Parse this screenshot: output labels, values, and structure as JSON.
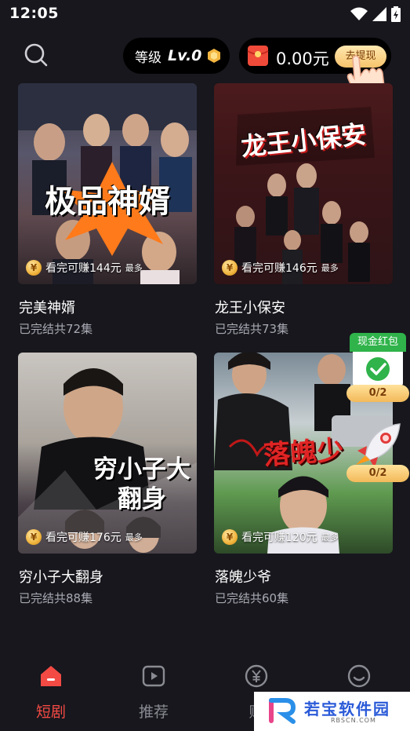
{
  "status_bar": {
    "time": "12:05"
  },
  "header": {
    "level_label": "等级",
    "level_value": "Lv.0",
    "wallet_amount": "0.00元",
    "withdraw_label": "去提现"
  },
  "dramas": [
    {
      "title": "完美神婿",
      "subtitle": "已完结共72集",
      "earn": "看完可赚144元",
      "earn_suffix": "最多",
      "poster_text": "极品神婿"
    },
    {
      "title": "龙王小保安",
      "subtitle": "已完结共73集",
      "earn": "看完可赚146元",
      "earn_suffix": "最多",
      "poster_text": "龙王小保安"
    },
    {
      "title": "穷小子大翻身",
      "subtitle": "已完结共88集",
      "earn": "看完可赚176元",
      "earn_suffix": "最多",
      "poster_text": "穷小子大翻身"
    },
    {
      "title": "落魄少爷",
      "subtitle": "已完结共60集",
      "earn": "看完可赚120元",
      "earn_suffix": "最多",
      "poster_text": "落魄少"
    }
  ],
  "coin_symbol": "¥",
  "redpacket": {
    "title": "现金红包",
    "progress": "0/2"
  },
  "rocket": {
    "progress": "0/2"
  },
  "nav": [
    {
      "label": "短剧",
      "icon": "home-icon",
      "active": true
    },
    {
      "label": "推荐",
      "icon": "play-icon",
      "active": false
    },
    {
      "label": "赚",
      "icon": "yen-icon",
      "active": false
    },
    {
      "label": "",
      "icon": "smile-icon",
      "active": false
    }
  ],
  "watermark": {
    "text": "若宝软件园",
    "url": "RBSCN.COM"
  },
  "colors": {
    "background": "#17171d",
    "accent_red": "#f44a44",
    "gold": "#f3b95a",
    "green": "#2fb34a"
  }
}
